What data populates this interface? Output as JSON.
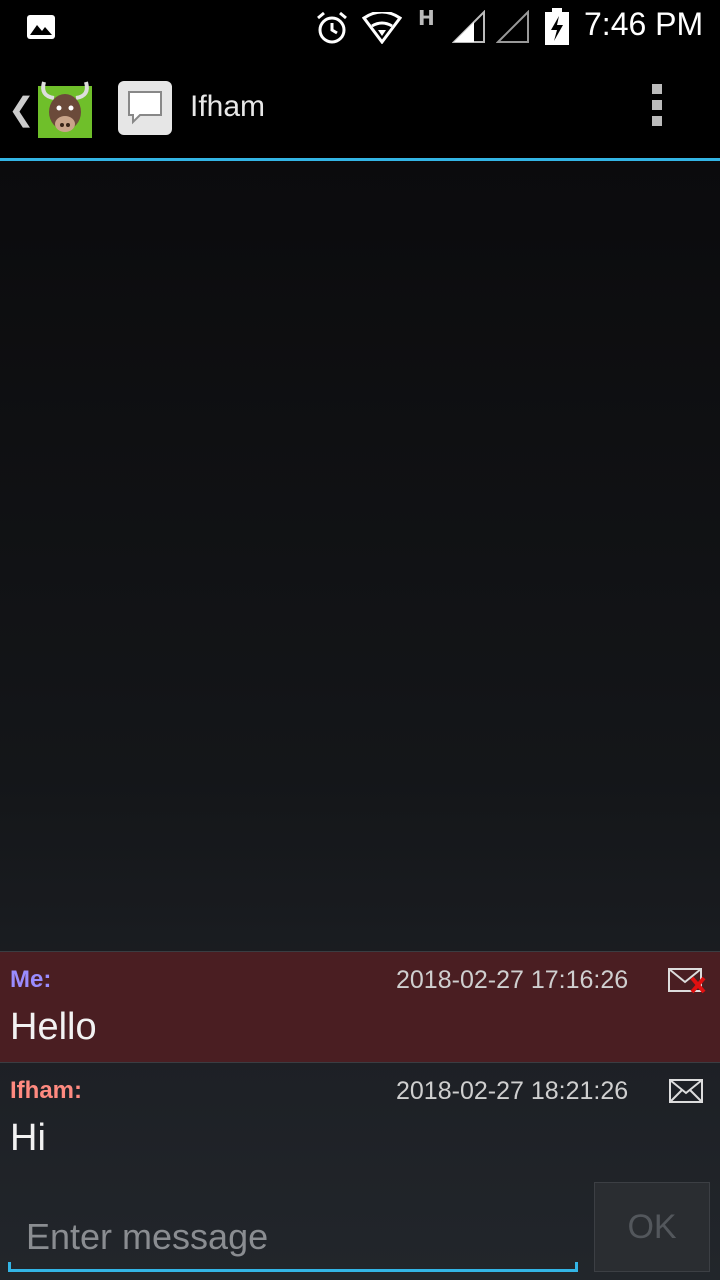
{
  "status_bar": {
    "network_type": "H",
    "time": "7:46 PM"
  },
  "action_bar": {
    "title": "Ifham"
  },
  "messages": [
    {
      "sender": "Me:",
      "timestamp": "2018-02-27 17:16:26",
      "text": "Hello",
      "status_icon": "mail-failed-icon"
    },
    {
      "sender": "Ifham:",
      "timestamp": "2018-02-27 18:21:26",
      "text": "Hi",
      "status_icon": "mail-icon"
    }
  ],
  "composer": {
    "placeholder": "Enter message",
    "send_label": "OK"
  },
  "colors": {
    "accent": "#33b5e5",
    "me_bubble": "#4a1e22",
    "me_sender": "#9a8cff",
    "them_sender": "#ff8a80"
  }
}
